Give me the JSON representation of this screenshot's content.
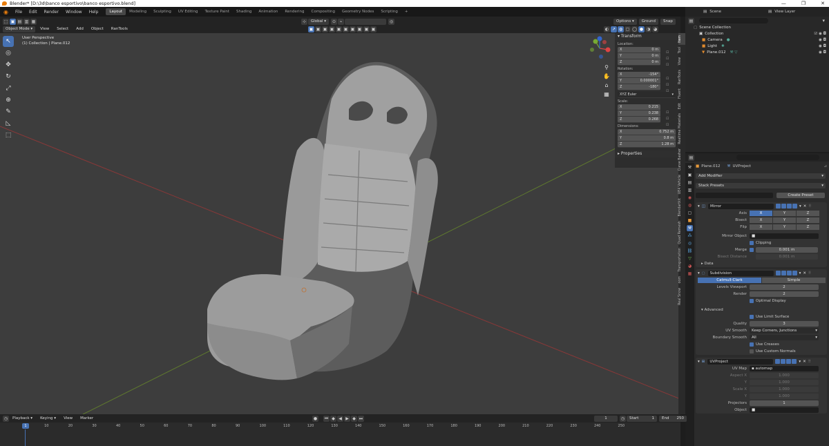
{
  "title": "Blender* [D:\\3d\\banco esportivo\\banco esportivo.blend]",
  "window_buttons": [
    "—",
    "❐",
    "✕"
  ],
  "menu": [
    "File",
    "Edit",
    "Render",
    "Window",
    "Help"
  ],
  "workspaces": [
    "Layout",
    "Modeling",
    "Sculpting",
    "UV Editing",
    "Texture Paint",
    "Shading",
    "Animation",
    "Rendering",
    "Compositing",
    "Geometry Nodes",
    "Scripting",
    "+"
  ],
  "scene": "Scene",
  "view_layer": "View Layer",
  "viewport": {
    "mode": "Object Mode",
    "menus": [
      "View",
      "Select",
      "Add",
      "Object",
      "RanTools"
    ],
    "orientation": "Global",
    "options": "Options",
    "ground": "Ground",
    "snap": "Snap",
    "info_line1": "User Perspective",
    "info_line2": "(1) Collection | Plane.012"
  },
  "npanel": {
    "transform": "Transform",
    "location_label": "Location:",
    "location": [
      [
        "X",
        "0 m"
      ],
      [
        "Y",
        "0 m"
      ],
      [
        "Z",
        "0 m"
      ]
    ],
    "rotation_label": "Rotation:",
    "rotation": [
      [
        "X",
        "-154°"
      ],
      [
        "Y",
        "0.000001°"
      ],
      [
        "Z",
        "-180°"
      ]
    ],
    "rotation_mode": "XYZ Euler",
    "scale_label": "Scale:",
    "scale": [
      [
        "X",
        "0.215"
      ],
      [
        "Y",
        "0.238"
      ],
      [
        "Z",
        "0.268"
      ]
    ],
    "dimensions_label": "Dimensions:",
    "dimensions": [
      [
        "X",
        "0.752 m"
      ],
      [
        "Y",
        "0.8 m"
      ],
      [
        "Z",
        "1.28 m"
      ]
    ],
    "properties": "Properties"
  },
  "vtabs": [
    "Item",
    "Tool",
    "View",
    "RanTools",
    "Fluent",
    "Edit",
    "Realtime Materials",
    "Curve Basher",
    "UE4 Vehicle",
    "Blendartkit",
    "Quad Remesh",
    "Transportation",
    "oom",
    "Real Snow"
  ],
  "outliner": {
    "root": "Scene Collection",
    "items": [
      {
        "name": "Collection",
        "indent": 1
      },
      {
        "name": "Camera",
        "indent": 2
      },
      {
        "name": "Light",
        "indent": 2
      },
      {
        "name": "Plane.012",
        "indent": 2
      }
    ]
  },
  "props": {
    "object": "Plane.012",
    "modifier_active": "UVProject",
    "add_modifier": "Add Modifier",
    "stack_presets": "Stack Presets",
    "create_preset": "Create Preset",
    "mirror": {
      "name": "Mirror",
      "axis_label": "Axis",
      "bisect_label": "Bisect",
      "flip_label": "Flip",
      "xyz": [
        "X",
        "Y",
        "Z"
      ],
      "mirror_object_label": "Mirror Object",
      "clipping": "Clipping",
      "merge_label": "Merge",
      "merge_value": "0.001 m",
      "bisect_distance_label": "Bisect Distance",
      "bisect_distance_value": "0.001 m",
      "data": "Data"
    },
    "subdivision": {
      "name": "Subdivision",
      "catmull": "Catmull-Clark",
      "simple": "Simple",
      "levels_label": "Levels Viewport",
      "levels_value": "2",
      "render_label": "Render",
      "render_value": "2",
      "optimal": "Optimal Display",
      "advanced": "Advanced",
      "use_limit": "Use Limit Surface",
      "quality_label": "Quality",
      "quality_value": "3",
      "uv_smooth_label": "UV Smooth",
      "uv_smooth_value": "Keep Corners, Junctions",
      "boundary_label": "Boundary Smooth",
      "boundary_value": "All",
      "use_creases": "Use Creases",
      "use_custom_normals": "Use Custom Normals"
    },
    "uvproject": {
      "name": "UVProject",
      "uvmap_label": "UV Map",
      "uvmap_value": "automap",
      "aspect_x_label": "Aspect X",
      "aspect_x": "1.000",
      "aspect_y_label": "Y",
      "aspect_y": "1.000",
      "scale_x_label": "Scale X",
      "scale_x": "1.000",
      "scale_y_label": "Y",
      "scale_y": "1.000",
      "projectors_label": "Projectors",
      "projectors_value": "1",
      "object_label": "Object"
    }
  },
  "timeline": {
    "menus": [
      "Playback",
      "Keying",
      "View",
      "Marker"
    ],
    "current_frame": "1",
    "start_label": "Start",
    "start": "1",
    "end_label": "End",
    "end": "250",
    "ticks": [
      "1",
      "10",
      "20",
      "30",
      "40",
      "50",
      "60",
      "70",
      "80",
      "90",
      "100",
      "110",
      "120",
      "130",
      "140",
      "150",
      "160",
      "170",
      "180",
      "190",
      "200",
      "210",
      "220",
      "230",
      "240",
      "250"
    ]
  },
  "colors": {
    "accent": "#4772b3",
    "viewport_bg": "#3d3d3d",
    "panel_bg": "#2b2b2b"
  }
}
